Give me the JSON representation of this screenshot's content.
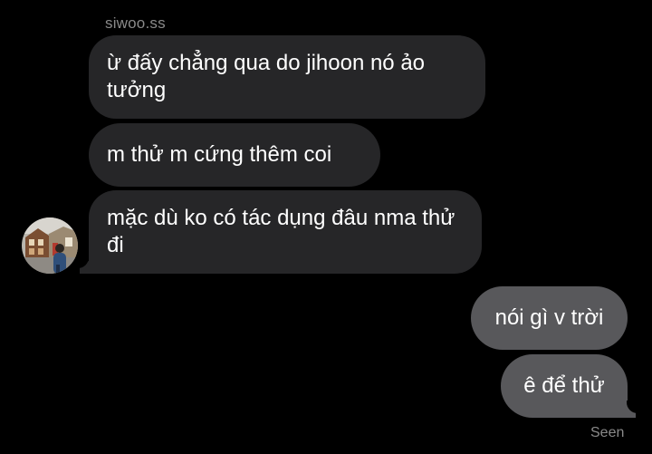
{
  "conversation": {
    "sender_name": "siwoo.ss",
    "incoming_messages": [
      "ừ đấy chẳng qua do jihoon nó ảo tưởng",
      "m thử m cứng thêm coi",
      "mặc dù ko có tác dụng đâu nma thử đi"
    ],
    "outgoing_messages": [
      "nói gì v trời",
      "ê để thử"
    ],
    "read_receipt": "Seen"
  },
  "colors": {
    "background": "#000000",
    "incoming_bubble": "#262628",
    "outgoing_bubble": "#58585b",
    "meta_text": "#8a8a8a",
    "message_text": "#ffffff"
  }
}
